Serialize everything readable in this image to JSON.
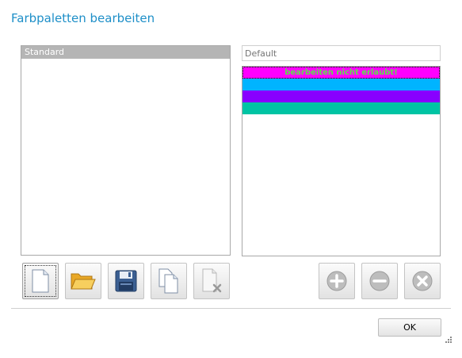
{
  "dialog": {
    "title": "Farbpaletten bearbeiten"
  },
  "palette_list": {
    "items": [
      {
        "label": "Standard",
        "selected": true
      }
    ]
  },
  "palette_name": {
    "value": "",
    "placeholder": "Default"
  },
  "palette_swatches": {
    "notice": "bearbeiten nicht erlaubt!",
    "colors": [
      "#ff00ff",
      "#00b4ff",
      "#8800ff",
      "#00c4a4"
    ]
  },
  "toolbar_left": [
    {
      "icon": "new-document-icon",
      "focused": true
    },
    {
      "icon": "open-folder-icon"
    },
    {
      "icon": "save-disk-icon"
    },
    {
      "icon": "copy-documents-icon"
    },
    {
      "icon": "delete-document-icon",
      "disabled": true
    }
  ],
  "toolbar_right": [
    {
      "icon": "add-circle-icon",
      "disabled": true
    },
    {
      "icon": "remove-circle-icon",
      "disabled": true
    },
    {
      "icon": "clear-circle-icon",
      "disabled": true
    }
  ],
  "footer": {
    "ok_label": "OK"
  },
  "colors": {
    "title": "#1e8fc8",
    "selection": "#b5b5b5",
    "notice_text": "#5fe04a"
  }
}
